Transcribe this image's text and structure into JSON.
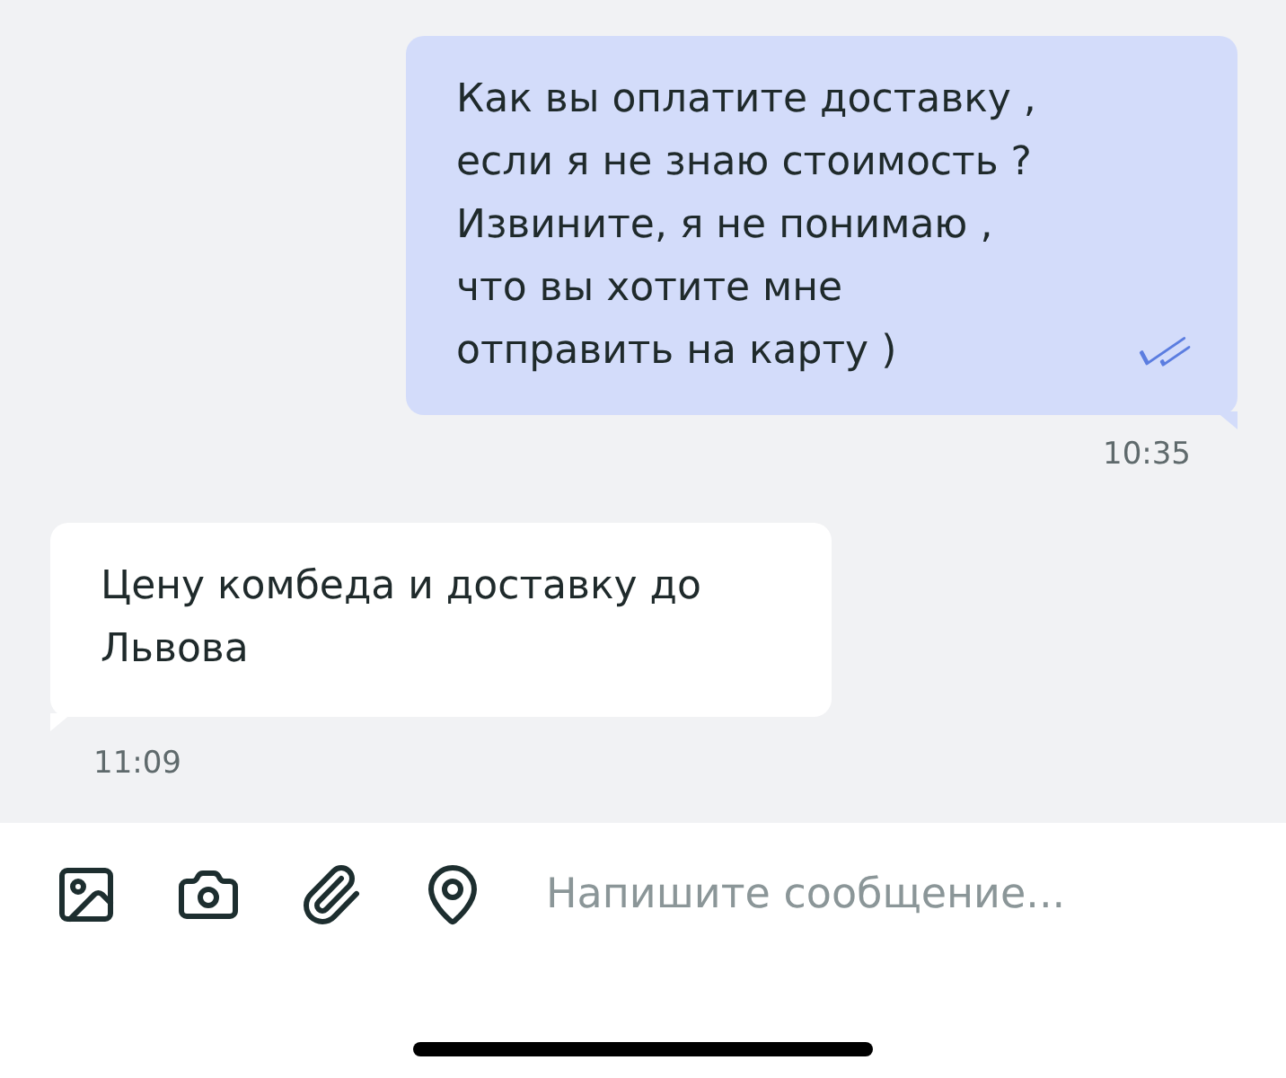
{
  "messages": [
    {
      "kind": "outgoing",
      "lines": [
        "Как вы оплатите доставку ,",
        "если я не знаю стоимость ?",
        "Извините, я не понимаю ,",
        "что вы хотите мне",
        "отправить на карту )"
      ],
      "time": "10:35",
      "read": true
    },
    {
      "kind": "incoming",
      "lines": [
        "Цену комбеда и доставку до",
        "Львова"
      ],
      "time": "11:09"
    }
  ],
  "composer": {
    "placeholder": "Напишите сообщение..."
  }
}
